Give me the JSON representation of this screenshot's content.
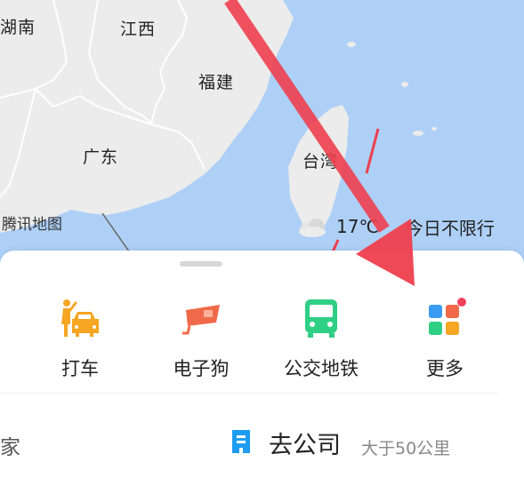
{
  "map": {
    "provinces": {
      "hunan": "湖南",
      "jiangxi": "江西",
      "fujian": "福建",
      "guangdong": "广东",
      "taiwan": "台湾"
    },
    "logo": "腾讯地图",
    "weather": {
      "icon": "cloud-icon",
      "temp": "17℃",
      "restriction": "今日不限行"
    },
    "colors": {
      "sea": "#aed0f7",
      "land": "#ececec",
      "border": "#ffffff",
      "arrow": "#ee3f4e"
    }
  },
  "quick_actions": [
    {
      "label": "打车",
      "icon": "taxi-icon",
      "color": "#f5a623"
    },
    {
      "label": "电子狗",
      "icon": "camera-dog-icon",
      "color": "#f06a4a"
    },
    {
      "label": "公交地铁",
      "icon": "bus-icon",
      "color": "#2fcf85"
    },
    {
      "label": "更多",
      "icon": "grid-more-icon",
      "badge_color": "#f2415a"
    }
  ],
  "destinations": {
    "home": "家",
    "company": "去公司",
    "company_distance": "大于50公里",
    "company_icon_color": "#1e9cf0"
  }
}
